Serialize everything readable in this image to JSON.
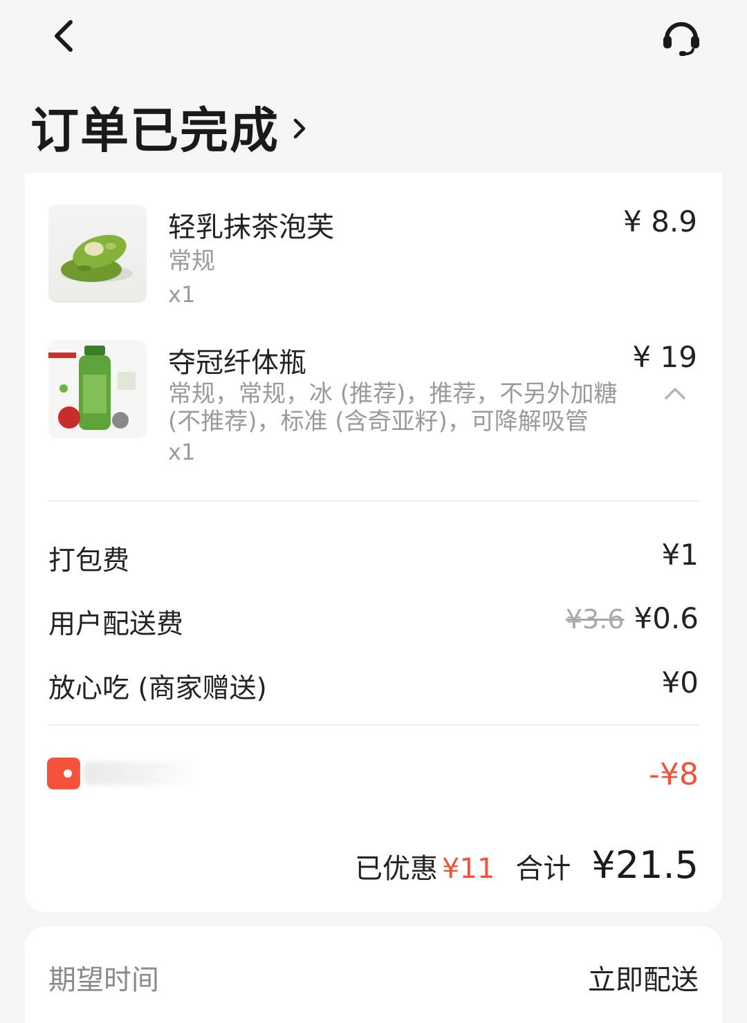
{
  "header": {
    "back_icon": "chevron-left-icon",
    "support_icon": "headset-icon",
    "title": "订单已完成",
    "title_icon": "chevron-right-icon"
  },
  "items": [
    {
      "name": "轻乳抹茶泡芙",
      "spec": "常规",
      "qty": "x1",
      "price": "¥ 8.9",
      "image": "matcha-puff-image"
    },
    {
      "name": "夺冠纤体瓶",
      "spec_line1": "常规，常规，冰 (推荐)，推荐，不另外加糖",
      "spec_line2": "(不推荐)，标准 (含奇亚籽)，可降解吸管",
      "qty": "x1",
      "price": "¥ 19",
      "image": "green-juice-bottle-image",
      "collapse_icon": "chevron-up-icon"
    }
  ],
  "fees": {
    "packing": {
      "label": "打包费",
      "value": "¥1"
    },
    "delivery": {
      "label": "用户配送费",
      "original": "¥3.6",
      "value": "¥0.6"
    },
    "assurance": {
      "label": "放心吃 (商家赠送)",
      "value": "¥0"
    }
  },
  "discount": {
    "icon": "coupon-icon",
    "value": "-¥8"
  },
  "summary": {
    "saved_label": "已优惠",
    "saved_value": "¥11",
    "total_label": "合计",
    "total_value": "¥21.5"
  },
  "delivery_time": {
    "label": "期望时间",
    "value": "立即配送"
  },
  "colors": {
    "accent": "#f2533a",
    "page_bg": "#f5f5f5",
    "card_bg": "#ffffff"
  }
}
